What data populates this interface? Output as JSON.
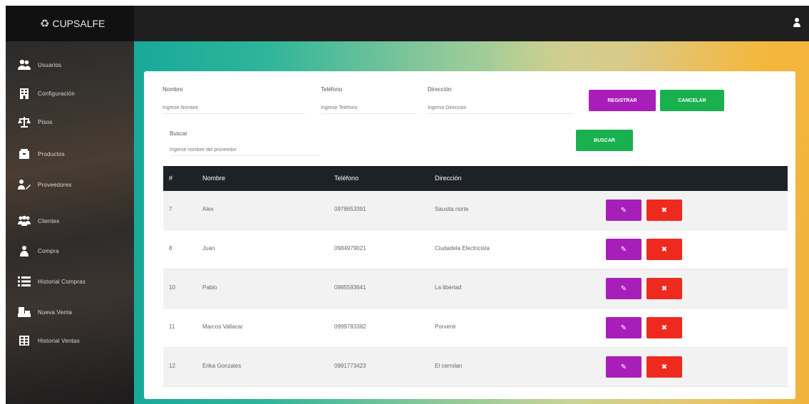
{
  "app": {
    "brand": "CUPSALFE",
    "brand_icon": "leaf-icon"
  },
  "sidebar": {
    "items": [
      {
        "label": "Usuarios",
        "icon": "users-icon"
      },
      {
        "label": "Configuración",
        "icon": "building-icon"
      },
      {
        "label": "Pisos",
        "icon": "scale-icon"
      },
      {
        "label": "Productos",
        "icon": "box-icon"
      },
      {
        "label": "Proveedores",
        "icon": "truck-icon"
      },
      {
        "label": "Clientes",
        "icon": "group-icon"
      },
      {
        "label": "Compra",
        "icon": "shopping-icon"
      },
      {
        "label": "Historial Compras",
        "icon": "list-icon"
      },
      {
        "label": "Nueva Venta",
        "icon": "cash-icon"
      },
      {
        "label": "Historial Ventas",
        "icon": "table-icon"
      }
    ]
  },
  "form": {
    "nombre": {
      "label": "Nombre",
      "placeholder": "Ingrese Nombre"
    },
    "telefono": {
      "label": "Teléfono",
      "placeholder": "Ingrese Teléfono"
    },
    "direccion": {
      "label": "Dirección",
      "placeholder": "Ingrese Dirección"
    },
    "registrar_label": "REGISTRAR",
    "cancelar_label": "CANCELAR",
    "buscar": {
      "label": "Buscar",
      "placeholder": "Ingrese nombre del proveedor"
    },
    "buscar_button": "BUSCAR"
  },
  "table": {
    "headers": [
      "#",
      "Nombre",
      "Teléfono",
      "Dirección"
    ],
    "rows": [
      {
        "id": "7",
        "nombre": "Alex",
        "telefono": "0978653391",
        "direccion": "Sausita norte"
      },
      {
        "id": "8",
        "nombre": "Juan",
        "telefono": "0984979021",
        "direccion": "Ciudadela Electricista"
      },
      {
        "id": "10",
        "nombre": "Pablo",
        "telefono": "0985593641",
        "direccion": "La libertad"
      },
      {
        "id": "11",
        "nombre": "Marcos Vallacar",
        "telefono": "0999783382",
        "direccion": "Porvenir"
      },
      {
        "id": "12",
        "nombre": "Erika Gonzales",
        "telefono": "0991773423",
        "direccion": "El cerrolan"
      }
    ],
    "edit_icon": "edit-icon",
    "delete_icon": "delete-icon"
  },
  "colors": {
    "topbar": "#1f1f1f",
    "purple": "#a71fb8",
    "green": "#19b04e",
    "red": "#ee2a1f",
    "table_header": "#1d2226"
  }
}
